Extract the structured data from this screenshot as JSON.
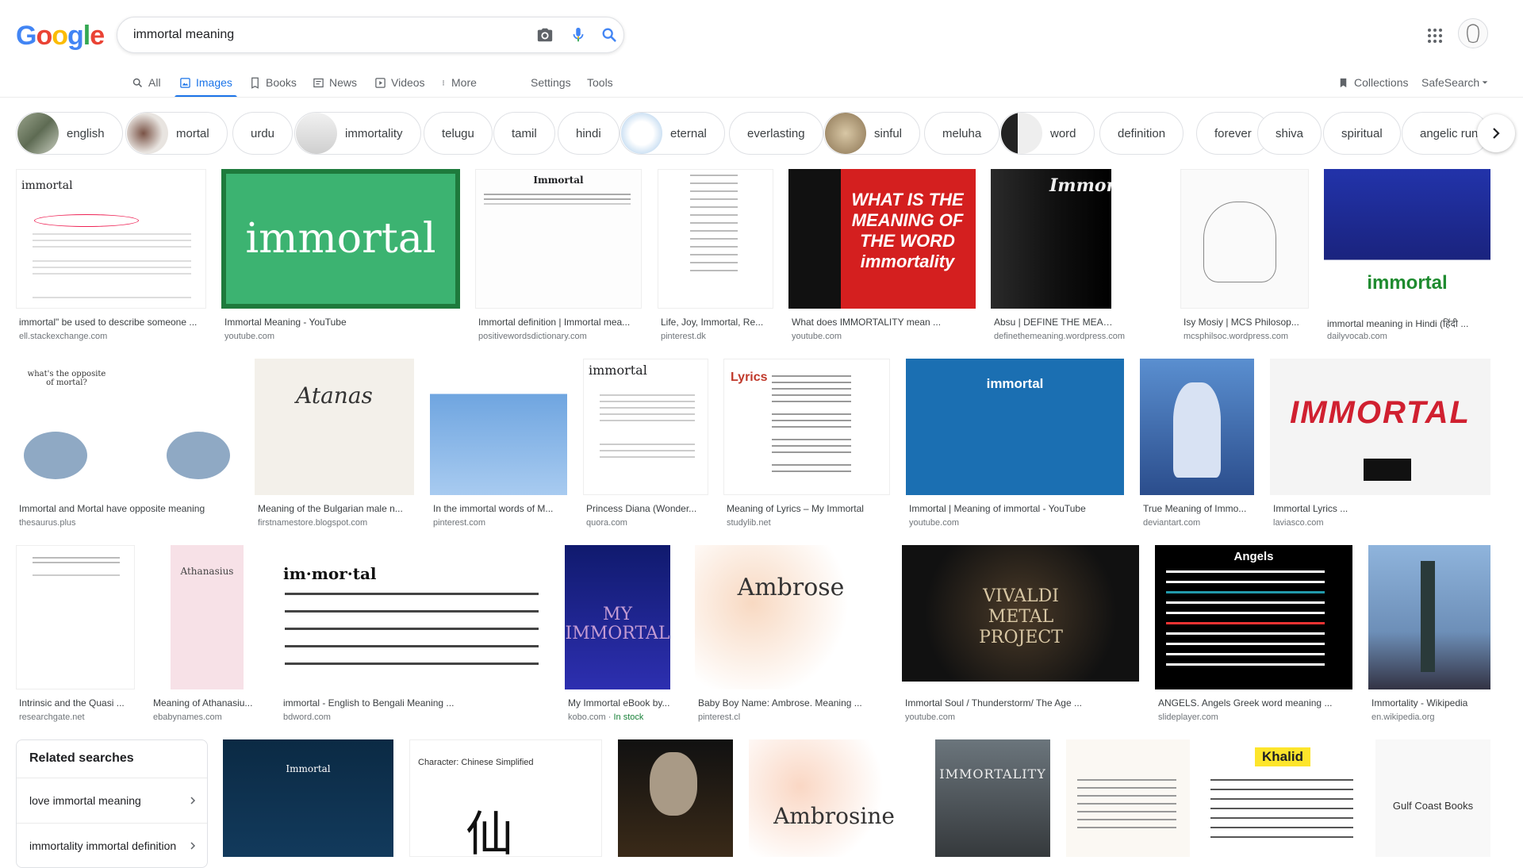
{
  "header": {
    "logo": "Google",
    "search_value": "immortal meaning",
    "icons": [
      "camera-icon",
      "mic-icon",
      "search-icon",
      "apps-icon",
      "avatar"
    ]
  },
  "tabs": [
    {
      "label": "All",
      "icon": "search-icon",
      "active": false
    },
    {
      "label": "Images",
      "icon": "image-icon",
      "active": true
    },
    {
      "label": "Books",
      "icon": "book-icon",
      "active": false
    },
    {
      "label": "News",
      "icon": "news-icon",
      "active": false
    },
    {
      "label": "Videos",
      "icon": "video-icon",
      "active": false
    },
    {
      "label": "More",
      "icon": "more-dots-icon",
      "active": false
    },
    {
      "label": "Settings"
    },
    {
      "label": "Tools"
    }
  ],
  "right_tools": {
    "collections": "Collections",
    "safesearch": "SafeSearch"
  },
  "chips": [
    "english",
    "mortal",
    "urdu",
    "immortality",
    "telugu",
    "tamil",
    "hindi",
    "eternal",
    "everlasting",
    "sinful",
    "meluha",
    "word",
    "definition",
    "forever",
    "shiva",
    "spiritual",
    "angelic rune"
  ],
  "results_row1": [
    {
      "caption": "immortal\" be used to describe someone ...",
      "source": "ell.stackexchange.com",
      "thumb_text": "immortal"
    },
    {
      "caption": "Immortal Meaning - YouTube",
      "source": "youtube.com",
      "thumb_text": "immortal"
    },
    {
      "caption": "Immortal definition | Immortal mea...",
      "source": "positivewordsdictionary.com",
      "thumb_text": "Immortal"
    },
    {
      "caption": "Life, Joy, Immortal, Re...",
      "source": "pinterest.dk",
      "thumb_text": ""
    },
    {
      "caption": "What does IMMORTALITY mean ...",
      "source": "youtube.com",
      "thumb_text": "WHAT IS THE MEANING OF THE WORD immortality"
    },
    {
      "caption": "Absu | DEFINE THE MEANING",
      "source": "definethemeaning.wordpress.com",
      "thumb_text": "Immort"
    },
    {
      "caption": "Isy Mosiy | MCS Philosop...",
      "source": "mcsphilsoc.wordpress.com",
      "thumb_text": ""
    },
    {
      "caption": "immortal meaning in Hindi (हिंदी ...",
      "source": "dailyvocab.com",
      "thumb_text": "immortal"
    }
  ],
  "results_row2": [
    {
      "caption": "Immortal and Mortal have opposite meaning",
      "source": "thesaurus.plus",
      "thumb_text": "what's the opposite of mortal?"
    },
    {
      "caption": "Meaning of the Bulgarian male n...",
      "source": "firstnamestore.blogspot.com",
      "thumb_text": "Atanas"
    },
    {
      "caption": "In the immortal words of M...",
      "source": "pinterest.com",
      "thumb_text": ""
    },
    {
      "caption": "Princess Diana (Wonder...",
      "source": "quora.com",
      "thumb_text": "immortal"
    },
    {
      "caption": "Meaning of Lyrics – My Immortal",
      "source": "studylib.net",
      "thumb_text": "Lyrics"
    },
    {
      "caption": "Immortal | Meaning of immortal - YouTube",
      "source": "youtube.com",
      "thumb_text": "immortal"
    },
    {
      "caption": "True Meaning of Immo...",
      "source": "deviantart.com",
      "thumb_text": ""
    },
    {
      "caption": "Immortal Lyrics ...",
      "source": "laviasco.com",
      "thumb_text": "IMMORTAL"
    }
  ],
  "results_row3": [
    {
      "caption": "Intrinsic and the Quasi ...",
      "source": "researchgate.net",
      "thumb_text": ""
    },
    {
      "caption": "Meaning of Athanasiu...",
      "source": "ebabynames.com",
      "thumb_text": "Athanasius"
    },
    {
      "caption": "immortal - English to Bengali Meaning ...",
      "source": "bdword.com",
      "thumb_text": "im·mor·tal"
    },
    {
      "caption": "My Immortal eBook by...",
      "source": "kobo.com",
      "in_stock": "In stock",
      "thumb_text": "MY IMMORTAL"
    },
    {
      "caption": "Baby Boy Name: Ambrose. Meaning ...",
      "source": "pinterest.cl",
      "thumb_text": "Ambrose"
    },
    {
      "caption": "Immortal Soul / Thunderstorm/ The Age ...",
      "source": "youtube.com",
      "thumb_text": "VIVALDI METAL PROJECT"
    },
    {
      "caption": "ANGELS. Angels Greek word meaning ...",
      "source": "slideplayer.com",
      "thumb_text": "Angels"
    },
    {
      "caption": "Immortality - Wikipedia",
      "source": "en.wikipedia.org",
      "thumb_text": ""
    }
  ],
  "related": {
    "title": "Related searches",
    "items": [
      "love immortal meaning",
      "immortality immortal definition"
    ]
  },
  "row4_thumbs": [
    "Immortal",
    "Character: Chinese Simplified",
    "",
    "Ambrosine",
    "IMMORTALITY",
    "",
    "Khalid",
    "Gulf Coast Books"
  ],
  "colors": {
    "accent": "#1a73e8",
    "text": "#202124",
    "muted": "#70757a",
    "stock": "#188038"
  }
}
